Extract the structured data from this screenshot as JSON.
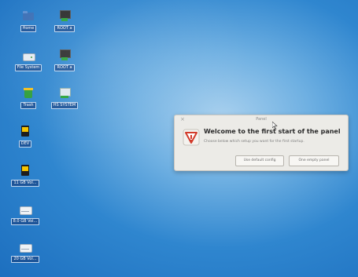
{
  "desktop": {
    "icons": [
      {
        "label": "Home",
        "icon": "folder-icon"
      },
      {
        "label": "ROOT a",
        "icon": "root-drive-icon"
      },
      {
        "label": "File System",
        "icon": "drive-icon"
      },
      {
        "label": "ROOT a",
        "icon": "root-drive-icon"
      },
      {
        "label": "Trash",
        "icon": "trash-icon"
      },
      {
        "label": "HS SYSTEM",
        "icon": "system-drive-icon"
      },
      {
        "label": "DEV",
        "icon": "usb-drive-icon"
      },
      {
        "label": "11 GB Vol...",
        "icon": "usb-drive-icon"
      },
      {
        "label": "8.0 GB Vol...",
        "icon": "volume-icon"
      },
      {
        "label": "20 GB Vol...",
        "icon": "volume-icon"
      }
    ]
  },
  "dialog": {
    "title": "Panel",
    "heading": "Welcome to the first start of the panel",
    "subtext": "Choose below which setup you want for the first startup.",
    "buttons": {
      "default_config": "Use default config",
      "empty_panel": "One empty panel"
    },
    "close_glyph": "×"
  },
  "colors": {
    "desktop_blue": "#2f86cf",
    "icon_label_bg": "#1c5296",
    "dialog_bg": "#ecebe7",
    "warning_red": "#d23a2a"
  }
}
